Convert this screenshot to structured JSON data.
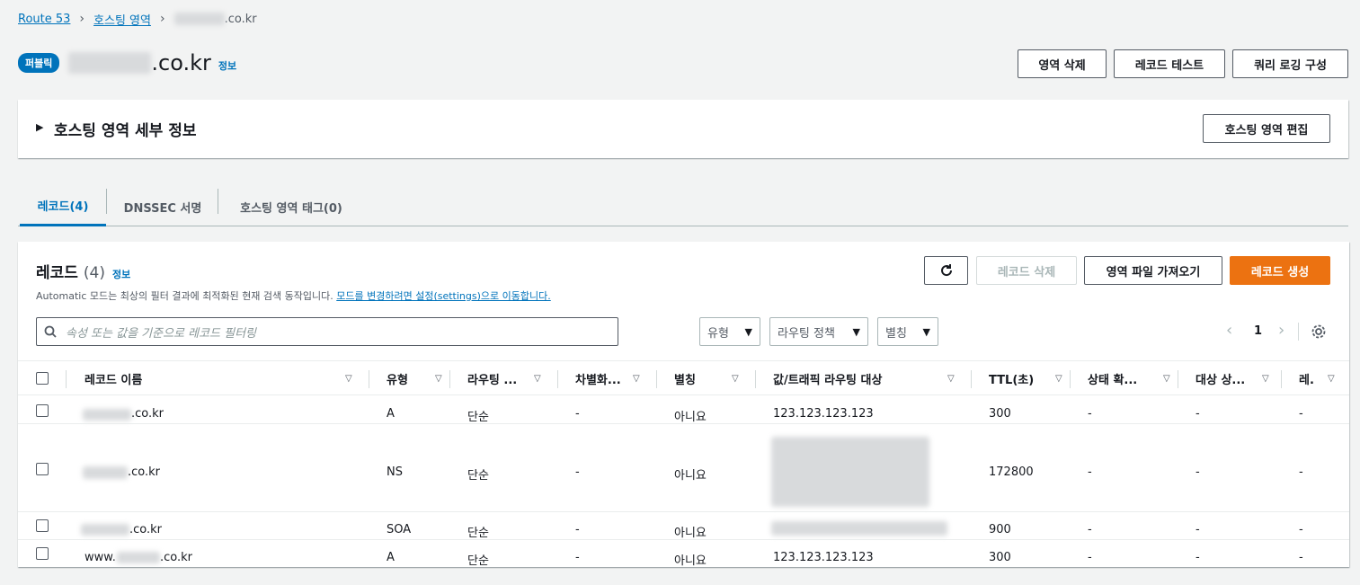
{
  "breadcrumb": {
    "root": "Route 53",
    "hosted_zones": "호스팅 영역",
    "current": ".co.kr"
  },
  "header": {
    "badge": "퍼블릭",
    "zone_suffix": ".co.kr",
    "info": "정보"
  },
  "header_buttons": {
    "delete_zone": "영역 삭제",
    "test_record": "레코드 테스트",
    "query_logging": "쿼리 로깅 구성"
  },
  "details": {
    "title": "호스팅 영역 세부 정보",
    "edit": "호스팅 영역 편집"
  },
  "tabs": [
    {
      "label": "레코드(4)"
    },
    {
      "label": "DNSSEC 서명"
    },
    {
      "label": "호스팅 영역 태그(0)"
    }
  ],
  "records": {
    "title": "레코드",
    "count": "(4)",
    "info": "정보",
    "description": "Automatic 모드는 최상의 필터 결과에 최적화된 현재 검색 동작입니다.",
    "description_link": "모드를 변경하려면 설정(settings)으로 이동합니다.",
    "buttons": {
      "delete": "레코드 삭제",
      "import": "영역 파일 가져오기",
      "create": "레코드 생성"
    },
    "search_placeholder": "속성 또는 값을 기준으로 레코드 필터링",
    "filters": {
      "type": "유형",
      "routing": "라우팅 정책",
      "alias": "별칭"
    },
    "page": "1",
    "columns": [
      "레코드 이름",
      "유형",
      "라우팅 ...",
      "차별화...",
      "별칭",
      "값/트래픽 라우팅 대상",
      "TTL(초)",
      "상태 확...",
      "대상 상...",
      "레."
    ],
    "rows": [
      {
        "name_prefix": "",
        "name_suffix": ".co.kr",
        "type": "A",
        "routing": "단순",
        "diff": "-",
        "alias": "아니요",
        "value": "123.123.123.123",
        "ttl": "300",
        "health": "-",
        "target": "-",
        "rid": "-"
      },
      {
        "name_prefix": "",
        "name_suffix": ".co.kr",
        "type": "NS",
        "routing": "단순",
        "diff": "-",
        "alias": "아니요",
        "value": "",
        "ttl": "172800",
        "health": "-",
        "target": "-",
        "rid": "-"
      },
      {
        "name_prefix": "",
        "name_suffix": ".co.kr",
        "type": "SOA",
        "routing": "단순",
        "diff": "-",
        "alias": "아니요",
        "value": "",
        "ttl": "900",
        "health": "-",
        "target": "-",
        "rid": "-"
      },
      {
        "name_prefix": "www.",
        "name_suffix": ".co.kr",
        "type": "A",
        "routing": "단순",
        "diff": "-",
        "alias": "아니요",
        "value": "123.123.123.123",
        "ttl": "300",
        "health": "-",
        "target": "-",
        "rid": "-"
      }
    ]
  },
  "colors": {
    "accent": "#0073bb",
    "primary": "#ec7211",
    "background": "#f2f3f3"
  }
}
